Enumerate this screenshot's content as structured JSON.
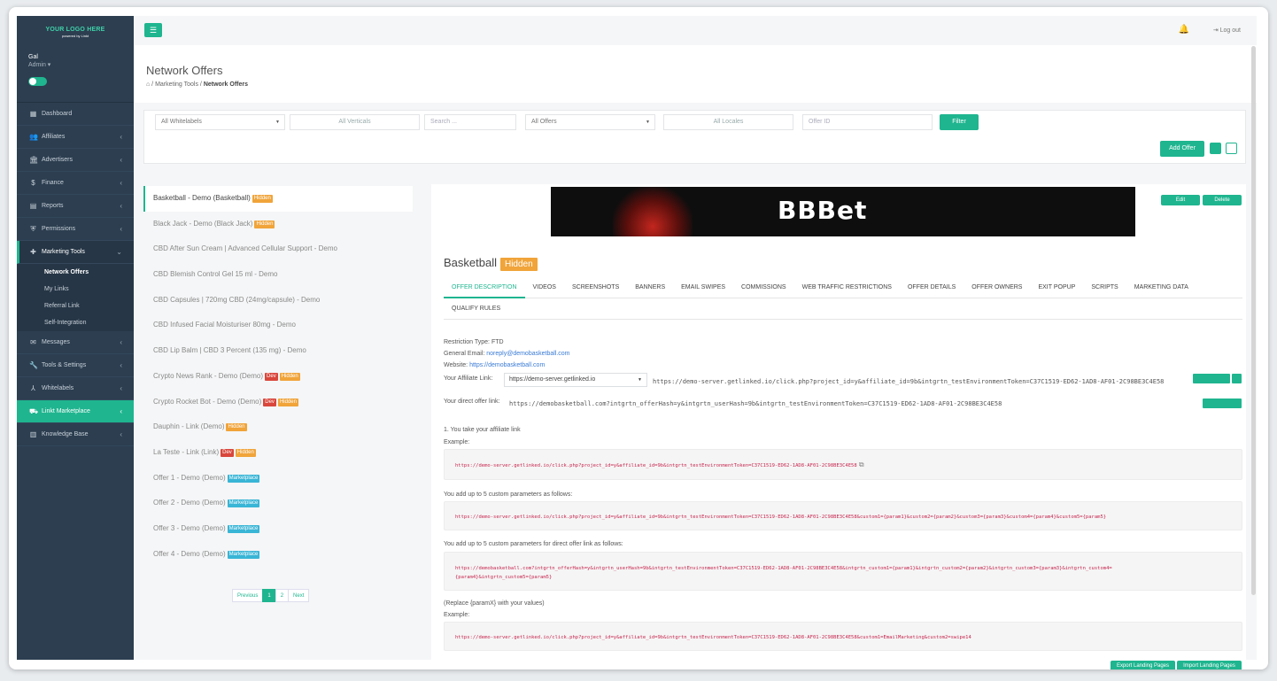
{
  "sidebar": {
    "logo_line1": "YOUR LOGO HERE",
    "logo_line2": "powered by Linkt",
    "user_name": "Gal",
    "user_role": "Admin ▾",
    "items": [
      {
        "label": "Dashboard",
        "icon": "dashboard-icon"
      },
      {
        "label": "Affiliates",
        "icon": "users-icon"
      },
      {
        "label": "Advertisers",
        "icon": "bank-icon"
      },
      {
        "label": "Finance",
        "icon": "dollar-icon"
      },
      {
        "label": "Reports",
        "icon": "report-icon"
      },
      {
        "label": "Permissions",
        "icon": "shield-icon"
      },
      {
        "label": "Marketing Tools",
        "icon": "puzzle-icon"
      }
    ],
    "submenu": [
      "Network Offers",
      "My Links",
      "Referral Link",
      "Self-Integration"
    ],
    "items2": [
      {
        "label": "Messages",
        "icon": "chat-icon"
      },
      {
        "label": "Tools & Settings",
        "icon": "wrench-icon"
      },
      {
        "label": "Whitelabels",
        "icon": "sitemap-icon"
      },
      {
        "label": "Linkt Marketplace",
        "icon": "basket-icon"
      },
      {
        "label": "Knowledge Base",
        "icon": "book-icon"
      }
    ]
  },
  "topbar": {
    "logout": "Log out"
  },
  "header": {
    "title": "Network Offers",
    "crumb1": "Marketing Tools",
    "crumb2": "Network Offers"
  },
  "filters": {
    "whitelabels": "All Whitelabels",
    "verticals": "All Verticals",
    "search_placeholder": "Search ...",
    "offers": "All Offers",
    "locales": "All Locales",
    "offer_id_placeholder": "Offer ID",
    "filter_btn": "Filter",
    "add_offer": "Add Offer"
  },
  "offers": [
    {
      "name": "Basketball - Demo (Basketball)",
      "tags": [
        "Hidden"
      ]
    },
    {
      "name": "Black Jack - Demo (Black Jack)",
      "tags": [
        "Hidden"
      ]
    },
    {
      "name": "CBD After Sun Cream | Advanced Cellular Support - Demo",
      "tags": []
    },
    {
      "name": "CBD Blemish Control Gel 15 ml - Demo",
      "tags": []
    },
    {
      "name": "CBD Capsules | 720mg CBD (24mg/capsule) - Demo",
      "tags": []
    },
    {
      "name": "CBD Infused Facial Moisturiser 80mg - Demo",
      "tags": []
    },
    {
      "name": "CBD Lip Balm | CBD 3 Percent (135 mg) - Demo",
      "tags": []
    },
    {
      "name": "Crypto News Rank - Demo (Demo)",
      "tags": [
        "Dev",
        "Hidden"
      ]
    },
    {
      "name": "Crypto Rocket Bot - Demo (Demo)",
      "tags": [
        "Dev",
        "Hidden"
      ]
    },
    {
      "name": "Dauphin - Link (Demo)",
      "tags": [
        "Hidden"
      ]
    },
    {
      "name": "La Teste - Link (Link)",
      "tags": [
        "Dev",
        "Hidden"
      ]
    },
    {
      "name": "Offer 1 - Demo (Demo)",
      "tags": [
        "Marketplace"
      ]
    },
    {
      "name": "Offer 2 - Demo (Demo)",
      "tags": [
        "Marketplace"
      ]
    },
    {
      "name": "Offer 3 - Demo (Demo)",
      "tags": [
        "Marketplace"
      ]
    },
    {
      "name": "Offer 4 - Demo (Demo)",
      "tags": [
        "Marketplace"
      ]
    }
  ],
  "pager": {
    "prev": "Previous",
    "p1": "1",
    "p2": "2",
    "next": "Next"
  },
  "detail": {
    "banner_text": "BBBet",
    "edit": "Edit",
    "delete": "Delete",
    "title": "Basketball",
    "title_tag": "Hidden",
    "tabs": [
      "OFFER DESCRIPTION",
      "VIDEOS",
      "SCREENSHOTS",
      "BANNERS",
      "EMAIL SWIPES",
      "COMMISSIONS",
      "WEB TRAFFIC RESTRICTIONS",
      "OFFER DETAILS",
      "OFFER OWNERS",
      "EXIT POPUP",
      "SCRIPTS",
      "MARKETING DATA"
    ],
    "tabs2": [
      "QUALIFY RULES"
    ],
    "restriction": "Restriction Type: FTD",
    "email_label": "General Email: ",
    "email": "noreply@demobasketball.com",
    "website_label": "Website: ",
    "website": "https://demobasketball.com",
    "aff_label": "Your Affiliate Link:",
    "aff_select": "https://demo-server.getlinked.io",
    "aff_link": "https://demo-server.getlinked.io/click.php?project_id=y&affiliate_id=9b&intgrtn_testEnvironmentToken=C37C1519-ED62-1AD8-AF01-2C98BE3C4E58",
    "direct_label": "Your direct offer link:",
    "direct_link": "https://demobasketball.com?intgrtn_offerHash=y&intgrtn_userHash=9b&intgrtn_testEnvironmentToken=C37C1519-ED62-1AD8-AF01-2C98BE3C4E58",
    "step1": "1. You take your affiliate link",
    "example": "Example:",
    "code1": "https://demo-server.getlinked.io/click.php?project_id=y&affiliate_id=9b&intgrtn_testEnvironmentToken=C37C1519-ED62-1AD8-AF01-2C98BE3C4E58",
    "step2": "You add up to 5 custom parameters as follows:",
    "code2": "https://demo-server.getlinked.io/click.php?project_id=y&affiliate_id=9b&intgrtn_testEnvironmentToken=C37C1519-ED62-1AD8-AF01-2C98BE3C4E58&custom1={param1}&custom2={param2}&custom3={param3}&custom4={param4}&custom5={param5}",
    "step3": "You add up to 5 custom parameters for direct offer link as follows:",
    "code3a": "https://demobasketball.com?intgrtn_offerHash=y&intgrtn_userHash=9b&intgrtn_testEnvironmentToken=C37C1519-ED62-1AD8-AF01-2C98BE3C4E58&intgrtn_custom1={param1}&intgrtn_custom2={param2}&intgrtn_custom3={param3}&intgrtn_custom4=",
    "code3b": "{param4}&intgrtn_custom5={param5}",
    "step4": "(Replace {paramX} with your values)",
    "code4": "https://demo-server.getlinked.io/click.php?project_id=y&affiliate_id=9b&intgrtn_testEnvironmentToken=C37C1519-ED62-1AD8-AF01-2C98BE3C4E58&custom1=EmailMarketing&custom2=swipe14",
    "export_btn": "Export Landing Pages",
    "import_btn": "Import Landing Pages"
  },
  "colors": {
    "accent": "#1fb58f",
    "sidebar": "#2c3e50",
    "hidden": "#f0a43a",
    "dev": "#d9463b",
    "marketplace": "#39b5d6"
  }
}
